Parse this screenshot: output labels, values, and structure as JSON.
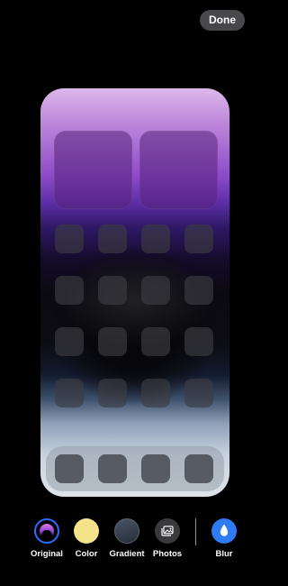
{
  "header": {
    "done_label": "Done"
  },
  "preview": {
    "widgets": 2,
    "app_rows": 4,
    "app_cols": 4,
    "dock_icons": 4
  },
  "options": {
    "original_label": "Original",
    "color_label": "Color",
    "gradient_label": "Gradient",
    "photos_label": "Photos",
    "blur_label": "Blur",
    "selected": "Original",
    "color_swatch": "#f5e38c",
    "blur_accent": "#2f7bf6",
    "original_ring": "#2f6bff"
  },
  "icons": {
    "photos": "photos-icon",
    "blur": "droplet-icon"
  }
}
